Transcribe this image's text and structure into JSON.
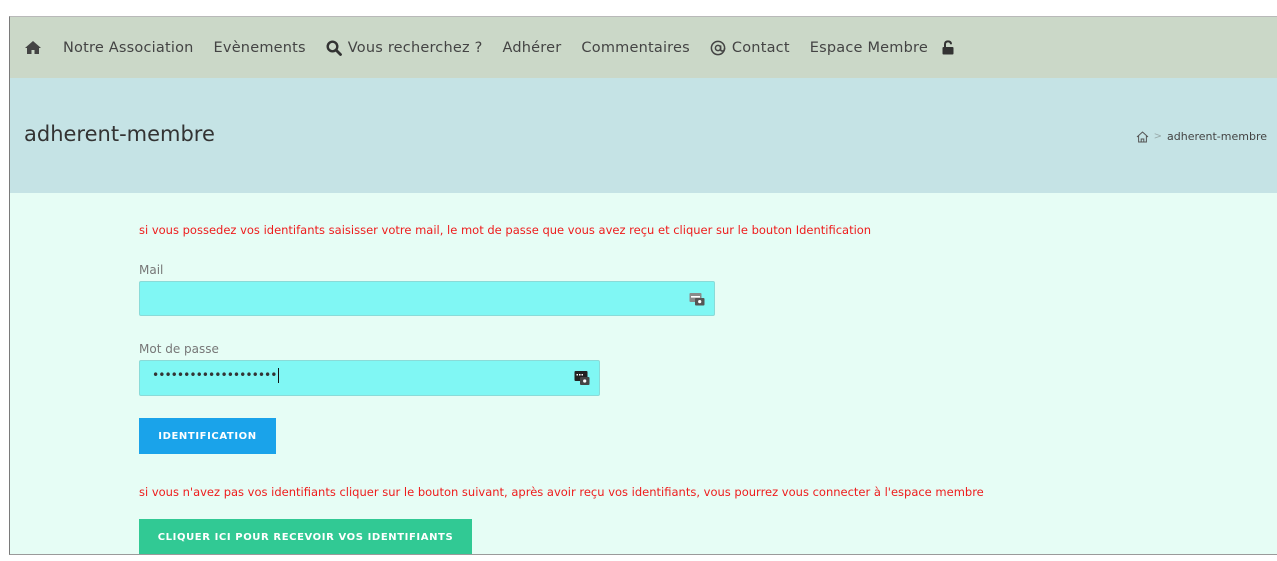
{
  "nav": {
    "items": [
      {
        "label": "Notre Association"
      },
      {
        "label": "Evènements"
      },
      {
        "label": "Vous recherchez ?"
      },
      {
        "label": "Adhérer"
      },
      {
        "label": "Commentaires"
      },
      {
        "label": "Contact"
      },
      {
        "label": "Espace Membre"
      }
    ]
  },
  "banner": {
    "title": "adherent-membre",
    "breadcrumb_separator": ">",
    "breadcrumb_current": "adherent-membre"
  },
  "form": {
    "notice_top": "si vous possedez vos identifants saisisser votre mail, le mot de passe que vous avez reçu et cliquer sur le bouton Identification",
    "mail_label": "Mail",
    "mail_value": "",
    "password_label": "Mot de passe",
    "password_mask": "••••••••••••••••••••",
    "identification_button": "IDENTIFICATION",
    "notice_bottom": "si vous n'avez pas vos identifiants cliquer sur le bouton suivant, après avoir reçu vos identifiants, vous pourrez vous connecter à l'espace membre",
    "receive_button": "CLIQUER ICI POUR RECEVOIR VOS IDENTIFIANTS"
  },
  "colors": {
    "nav_bg": "#cbd8c8",
    "banner_bg": "#c5e3e5",
    "content_bg": "#e6fdf5",
    "notice_red": "#ee1c1c",
    "input_bg": "#80f7f4",
    "button_blue": "#1aa3ea",
    "button_green": "#31c994"
  },
  "icons": [
    "home-icon",
    "search-icon",
    "at-icon",
    "unlock-icon",
    "breadcrumb-home-icon",
    "password-manager-icon"
  ]
}
